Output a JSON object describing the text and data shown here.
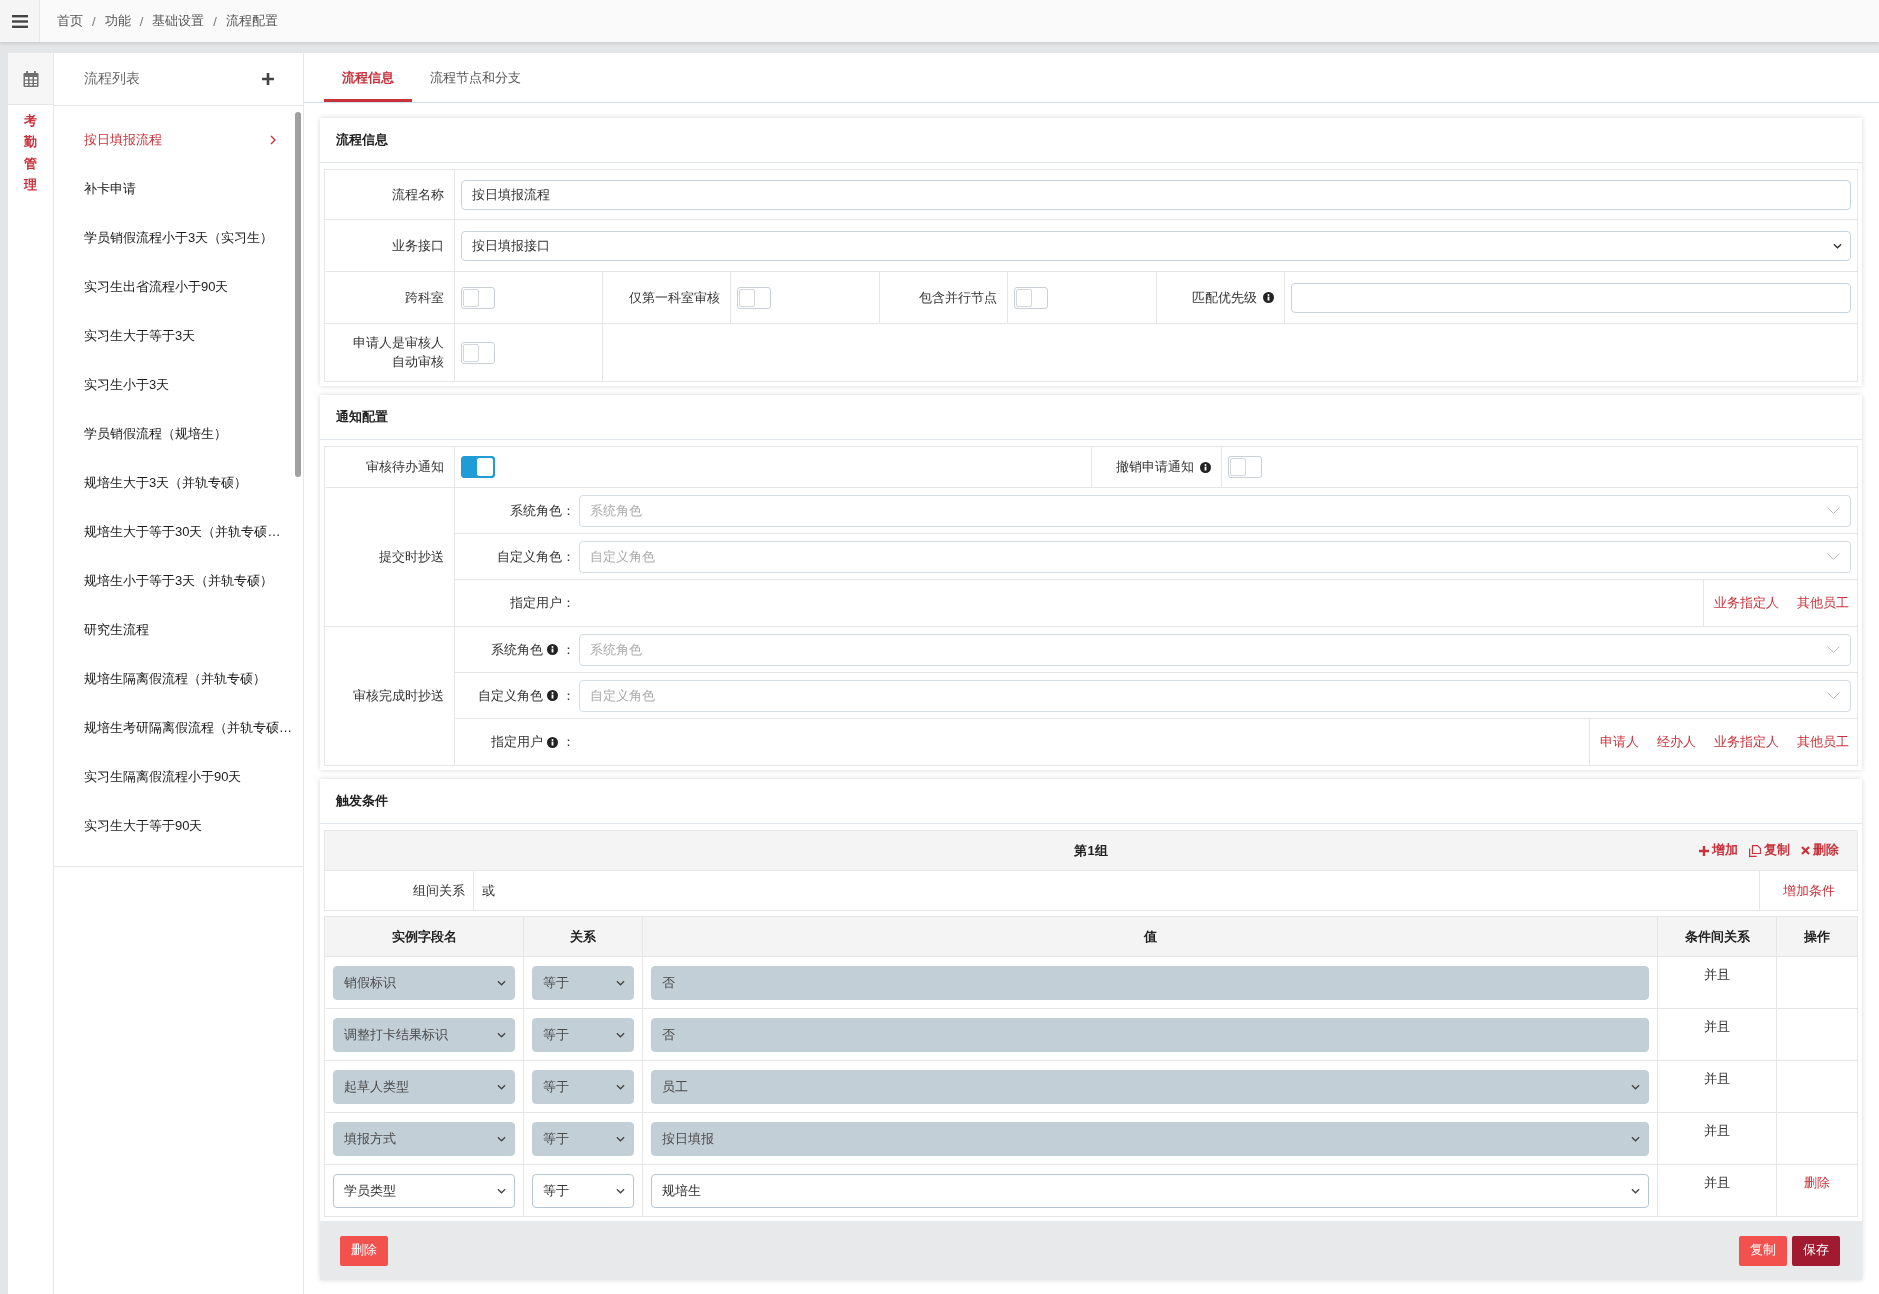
{
  "header": {
    "breadcrumb": [
      {
        "kind": "link",
        "text": "首页"
      },
      {
        "kind": "separator",
        "text": "/"
      },
      {
        "kind": "link",
        "text": "功能"
      },
      {
        "kind": "separator",
        "text": "/"
      },
      {
        "kind": "link",
        "text": "基础设置"
      },
      {
        "kind": "separator",
        "text": "/"
      },
      {
        "kind": "current",
        "text": "流程配置"
      }
    ]
  },
  "side_nav": {
    "items": [
      {
        "label": "考勤管理",
        "selected": true
      }
    ]
  },
  "flow_list": {
    "title": "流程列表",
    "items": [
      {
        "label": "按日填报流程",
        "selected": true
      },
      {
        "label": "补卡申请",
        "selected": false
      },
      {
        "label": "学员销假流程小于3天（实习生）",
        "selected": false
      },
      {
        "label": "实习生出省流程小于90天",
        "selected": false
      },
      {
        "label": "实习生大于等于3天",
        "selected": false
      },
      {
        "label": "实习生小于3天",
        "selected": false
      },
      {
        "label": "学员销假流程（规培生）",
        "selected": false
      },
      {
        "label": "规培生大于3天（并轨专硕）",
        "selected": false
      },
      {
        "label": "规培生大于等于30天（并轨专硕…",
        "selected": false
      },
      {
        "label": "规培生小于等于3天（并轨专硕）",
        "selected": false
      },
      {
        "label": "研究生流程",
        "selected": false
      },
      {
        "label": "规培生隔离假流程（并轨专硕）",
        "selected": false
      },
      {
        "label": "规培生考研隔离假流程（并轨专硕…",
        "selected": false
      },
      {
        "label": "实习生隔离假流程小于90天",
        "selected": false
      },
      {
        "label": "实习生大于等于90天",
        "selected": false
      }
    ]
  },
  "tabs": [
    {
      "label": "流程信息",
      "selected": true
    },
    {
      "label": "流程节点和分支",
      "selected": false
    }
  ],
  "flow_info": {
    "title": "流程信息",
    "name_field": {
      "label": "流程名称",
      "value": "按日填报流程"
    },
    "interface_field": {
      "label": "业务接口",
      "value": "按日填报接口"
    },
    "switches": [
      {
        "label": "跨科室",
        "on": false
      },
      {
        "label": "仅第一科室审核",
        "on": false
      },
      {
        "label": "包含并行节点",
        "on": false
      }
    ],
    "priority_field": {
      "label": "匹配优先级",
      "info": true
    },
    "auto_approve": {
      "label": "申请人是审核人自动审核",
      "on": false
    }
  },
  "notify": {
    "title": "通知配置",
    "switches": [
      {
        "label": "审核待办通知",
        "on": true,
        "info": false
      },
      {
        "label": "撤销申请通知",
        "on": false,
        "info": true
      }
    ],
    "cc_groups": [
      {
        "label": "提交时抄送",
        "role_fields": [
          {
            "label": "系统角色",
            "info": false,
            "colon": "：",
            "placeholder": "系统角色"
          },
          {
            "label": "自定义角色",
            "info": false,
            "colon": "：",
            "placeholder": "自定义角色"
          }
        ],
        "users": {
          "label": "指定用户",
          "info": false,
          "colon": "：",
          "links": [
            "业务指定人",
            "其他员工"
          ]
        }
      },
      {
        "label": "审核完成时抄送",
        "role_fields": [
          {
            "label": "系统角色",
            "info": true,
            "colon": "：",
            "placeholder": "系统角色"
          },
          {
            "label": "自定义角色",
            "info": true,
            "colon": "：",
            "placeholder": "自定义角色"
          }
        ],
        "users": {
          "label": "指定用户",
          "info": true,
          "colon": "：",
          "links": [
            "申请人",
            "经办人",
            "业务指定人",
            "其他员工"
          ]
        }
      }
    ]
  },
  "trigger": {
    "title": "触发条件",
    "groups": [
      {
        "title": "第1组",
        "actions": [
          {
            "kind": "add",
            "label": "增加"
          },
          {
            "kind": "copy",
            "label": "复制"
          },
          {
            "kind": "delete",
            "label": "删除"
          }
        ],
        "relation": {
          "label": "组间关系",
          "value": "或"
        },
        "add_condition": "增加条件",
        "columns": [
          "实例字段名",
          "关系",
          "值",
          "条件间关系",
          "操作"
        ],
        "rows": [
          {
            "kind": "input",
            "field": "销假标识",
            "operator": "等于",
            "value": "否",
            "logic": "并且",
            "disabled": true
          },
          {
            "kind": "input",
            "field": "调整打卡结果标识",
            "operator": "等于",
            "value": "否",
            "logic": "并且",
            "disabled": true
          },
          {
            "kind": "select",
            "field": "起草人类型",
            "operator": "等于",
            "value": "员工",
            "logic": "并且",
            "disabled": true
          },
          {
            "kind": "select",
            "field": "填报方式",
            "operator": "等于",
            "value": "按日填报",
            "logic": "并且",
            "disabled": true
          },
          {
            "kind": "select",
            "field": "学员类型",
            "operator": "等于",
            "value": "规培生",
            "logic": "并且",
            "disabled": false,
            "action": "删除"
          }
        ]
      }
    ],
    "footer": {
      "left": [
        {
          "label": "删除"
        }
      ],
      "right": [
        {
          "label": "复制"
        },
        {
          "label": "保存"
        }
      ]
    }
  }
}
